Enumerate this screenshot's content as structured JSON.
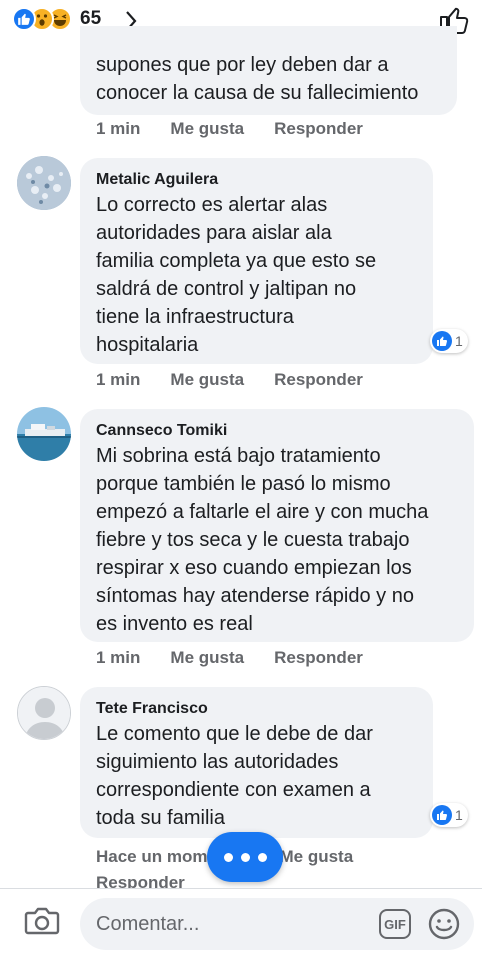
{
  "reactions": {
    "count": "65",
    "types": [
      "like-icon",
      "wow-icon",
      "haha-icon"
    ]
  },
  "comments": [
    {
      "author": "",
      "text": "supones que por ley deben dar a\nconocer la causa de su fallecimiento",
      "time": "1 min",
      "like": "Me gusta",
      "reply": "Responder"
    },
    {
      "author": "Metalic Aguilera",
      "text": "Lo correcto es alertar alas\nautoridades para aislar ala\nfamilia completa ya que esto se\nsaldrá de control y jaltipan no\ntiene la infraestructura\nhospitalaria",
      "time": "1 min",
      "like": "Me gusta",
      "reply": "Responder",
      "likes": "1"
    },
    {
      "author": "Cannseco Tomiki",
      "text": "Mi sobrina está bajo tratamiento\nporque también le pasó lo mismo\nempezó a faltarle el aire y con mucha\nfiebre y tos seca y le cuesta trabajo\nrespirar x eso cuando empiezan los\nsíntomas hay atenderse rápido y no\nes invento es real",
      "time": "1 min",
      "like": "Me gusta",
      "reply": "Responder"
    },
    {
      "author": "Tete Francisco",
      "text": "Le comento que le debe de dar\nsiguimiento las autoridades\ncorrespondiente con examen a\ntoda su familia",
      "time": "Hace un mom",
      "like": "Me gusta",
      "reply": "Responder",
      "likes": "1"
    }
  ],
  "composer": {
    "placeholder": "Comentar...",
    "gif_label": "GIF"
  },
  "colors": {
    "accent": "#1877f2",
    "bubble": "#f0f2f5",
    "meta": "#65676b"
  }
}
